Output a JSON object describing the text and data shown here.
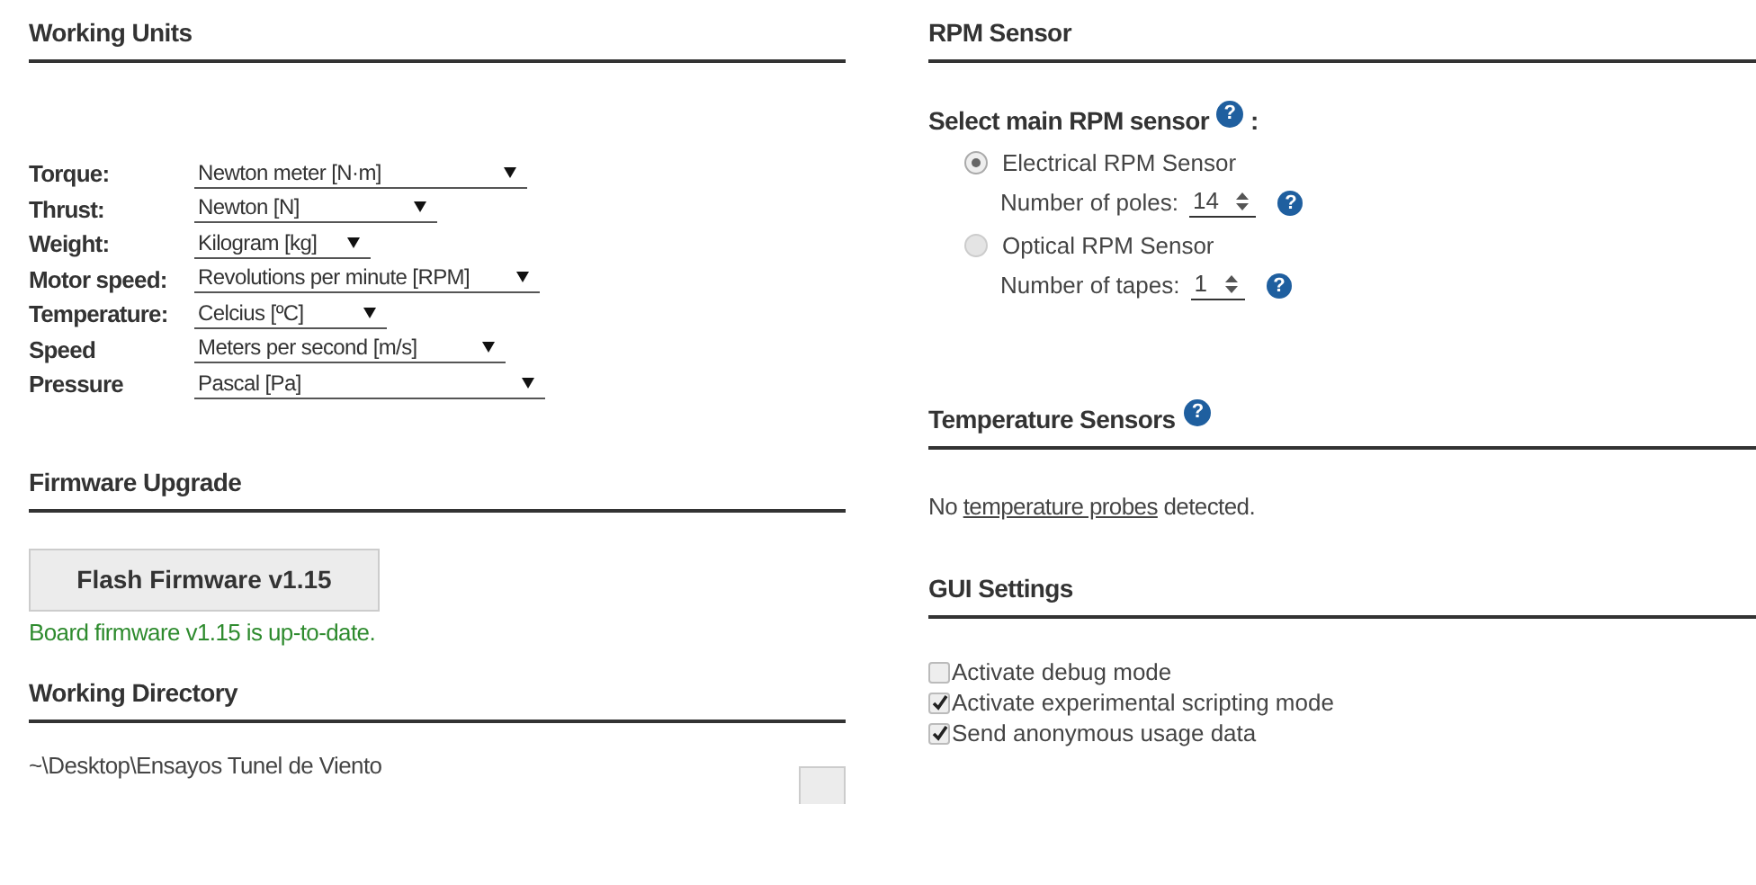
{
  "working_units": {
    "title": "Working Units",
    "rows": [
      {
        "label": "Torque:",
        "value": "Newton meter [N·m]"
      },
      {
        "label": "Thrust:",
        "value": "Newton [N]"
      },
      {
        "label": "Weight:",
        "value": "Kilogram [kg]"
      },
      {
        "label": "Motor speed:",
        "value": "Revolutions per minute [RPM]"
      },
      {
        "label": "Temperature:",
        "value": "Celcius [ºC]"
      },
      {
        "label": "Speed",
        "value": "Meters per second [m/s]"
      },
      {
        "label": "Pressure",
        "value": "Pascal [Pa]"
      }
    ]
  },
  "firmware": {
    "title": "Firmware Upgrade",
    "button": "Flash Firmware v1.15",
    "status": "Board firmware v1.15 is up-to-date."
  },
  "directory": {
    "title": "Working Directory",
    "path": "~\\Desktop\\Ensayos Tunel de Viento"
  },
  "rpm": {
    "title": "RPM Sensor",
    "prompt": "Select main RPM sensor",
    "prompt_help": "?",
    "prompt_suffix": ":",
    "options": [
      {
        "label": "Electrical RPM Sensor",
        "selected": true,
        "field_label": "Number of poles:",
        "value": "14",
        "help": "?"
      },
      {
        "label": "Optical RPM Sensor",
        "selected": false,
        "field_label": "Number of tapes:",
        "value": "1",
        "help": "?"
      }
    ]
  },
  "temperature": {
    "title": "Temperature Sensors",
    "help": "?",
    "message_before": "No",
    "link": "temperature probes",
    "message_after": "detected."
  },
  "gui": {
    "title": "GUI Settings",
    "options": [
      {
        "label": "Activate debug mode",
        "checked": false
      },
      {
        "label": "Activate experimental scripting mode",
        "checked": true
      },
      {
        "label": "Send anonymous usage data",
        "checked": true
      }
    ]
  }
}
